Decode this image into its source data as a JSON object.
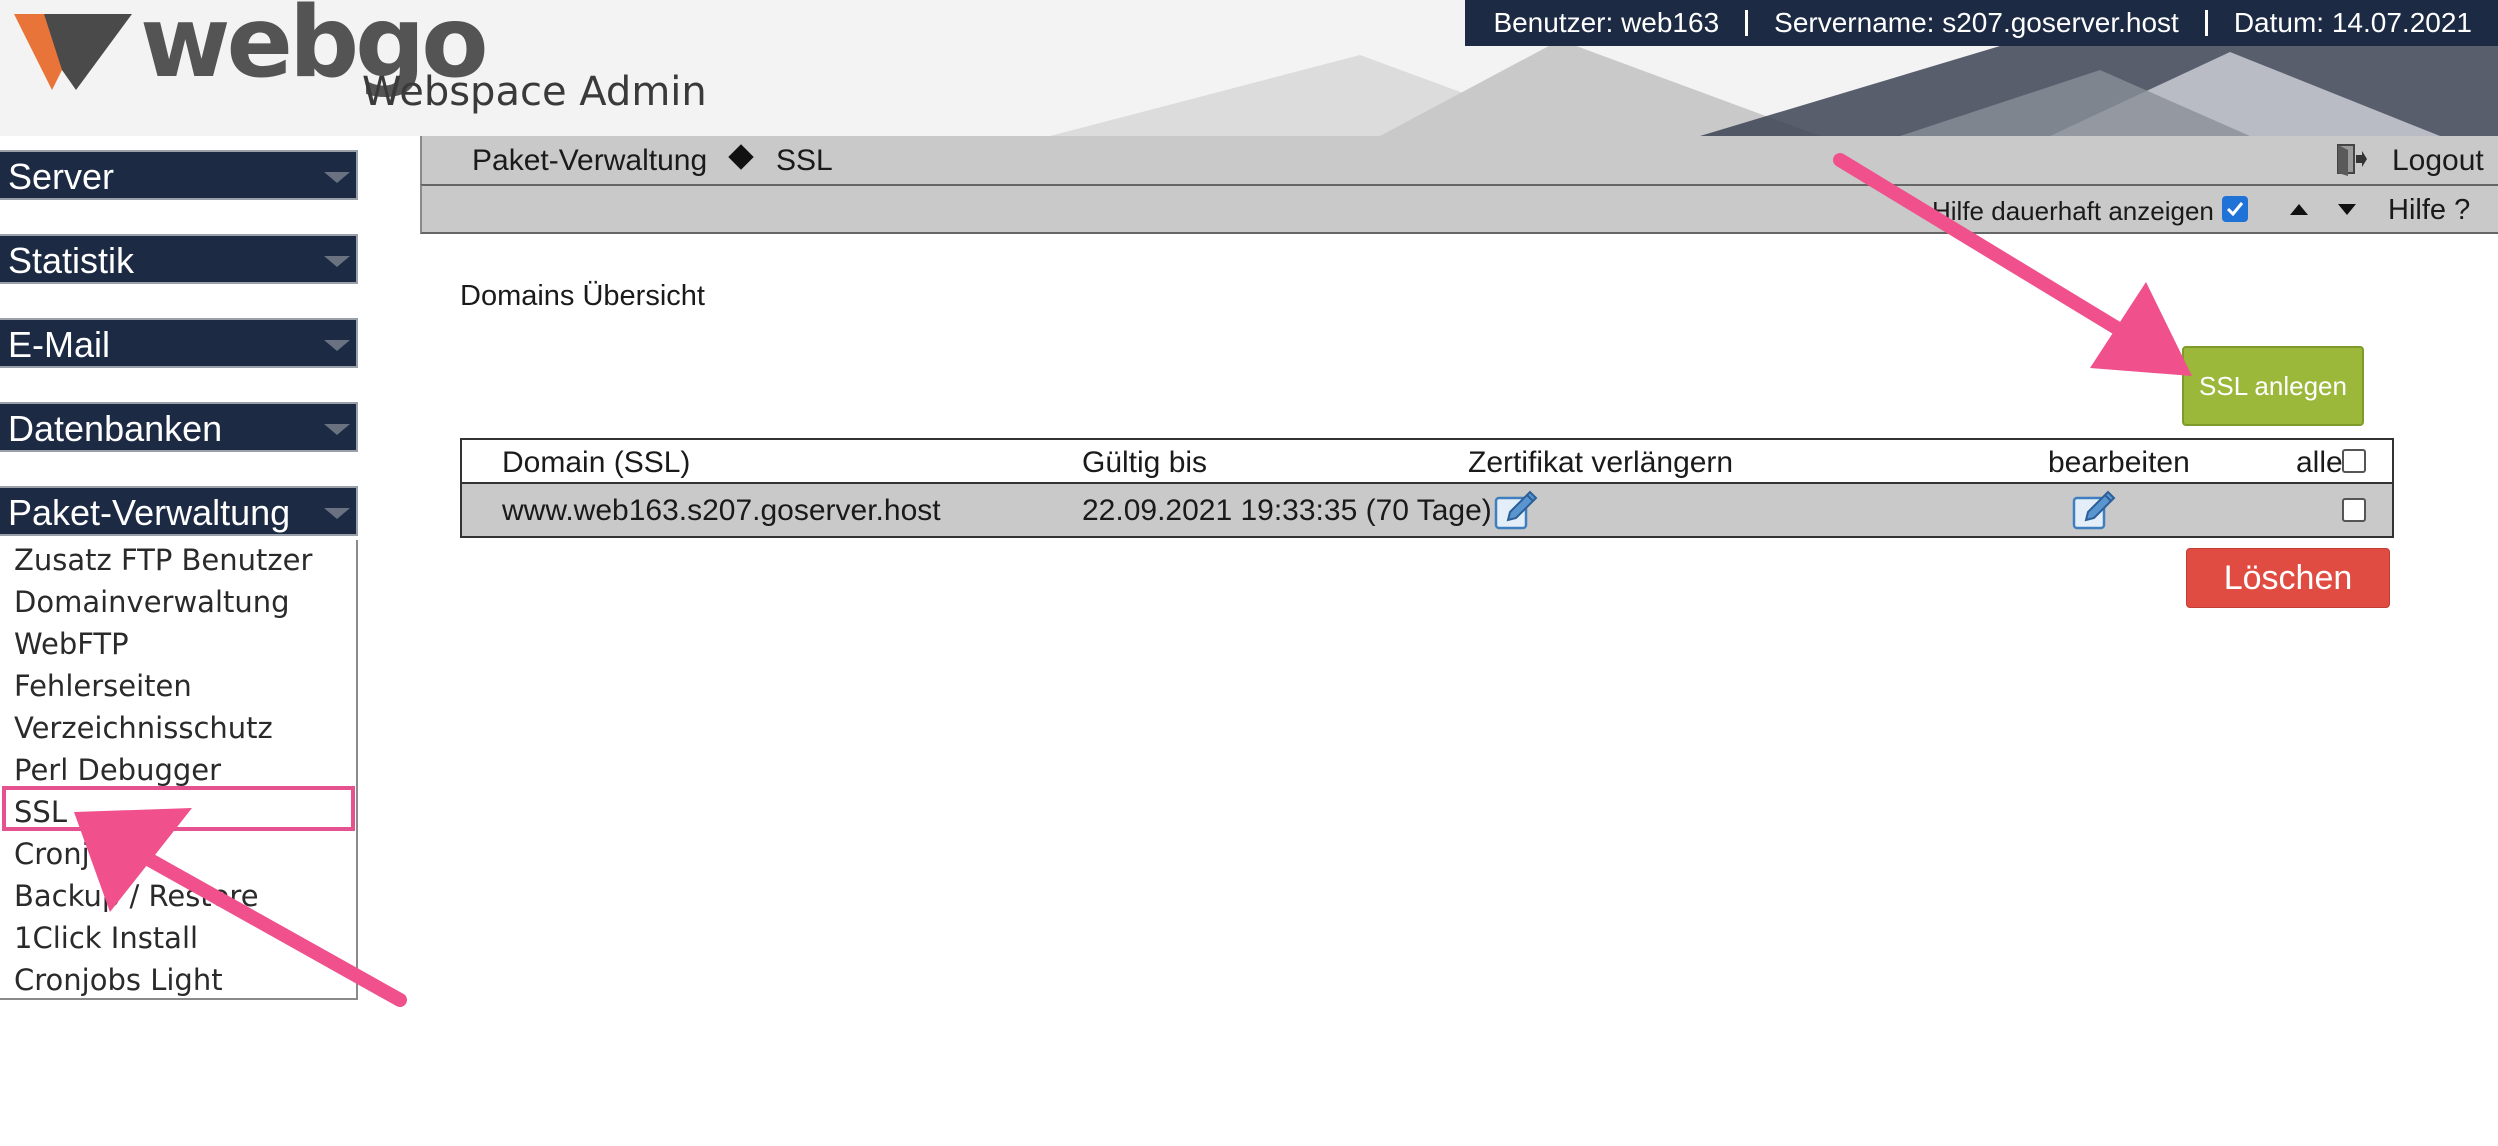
{
  "header": {
    "brand": "webgo",
    "subtitle": "Webspace Admin",
    "user": "Benutzer: web163",
    "server": "Servername: s207.goserver.host",
    "date": "Datum: 14.07.2021"
  },
  "sidebar": {
    "menus": [
      "Server",
      "Statistik",
      "E-Mail",
      "Datenbanken",
      "Paket-Verwaltung"
    ],
    "items": [
      "Zusatz FTP Benutzer",
      "Domainverwaltung",
      "WebFTP",
      "Fehlerseiten",
      "Verzeichnisschutz",
      "Perl Debugger",
      "SSL",
      "Cronjobs",
      "Backup / Restore",
      "1Click Install",
      "Cronjobs Light"
    ]
  },
  "nav": {
    "breadcrumb_parent": "Paket-Verwaltung",
    "breadcrumb_current": "SSL",
    "logout": "Logout",
    "help_permanent": "Hilfe dauerhaft anzeigen",
    "help": "Hilfe ?"
  },
  "main": {
    "section_title": "Domains Übersicht",
    "add_button": "SSL anlegen",
    "delete_button": "Löschen",
    "table": {
      "headers": [
        "Domain (SSL)",
        "Gültig bis",
        "Zertifikat verlängern",
        "bearbeiten",
        "alle"
      ],
      "rows": [
        {
          "domain": "www.web163.s207.goserver.host",
          "valid_until": "22.09.2021 19:33:35 (70 Tage)"
        }
      ]
    }
  },
  "colors": {
    "navy": "#1c2a44",
    "accent_green": "#9bb83b",
    "danger_red": "#e04c41",
    "annotation_pink": "#f0508c"
  }
}
